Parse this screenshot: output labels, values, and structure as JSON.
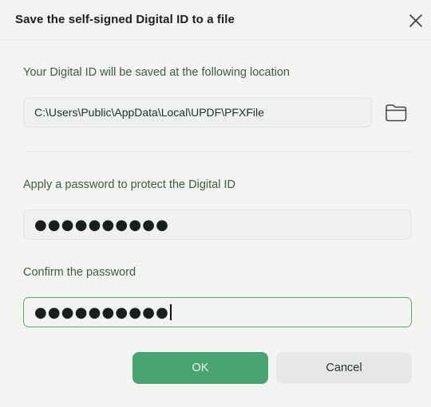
{
  "dialog": {
    "title": "Save the self-signed Digital ID to a file",
    "close_icon": "close-icon"
  },
  "location": {
    "label": "Your Digital ID will be saved at the following location",
    "path_value": "C:\\Users\\Public\\AppData\\Local\\UPDF\\PFXFile",
    "browse_icon": "folder-icon"
  },
  "password": {
    "label": "Apply a password to protect the Digital ID",
    "masked_value": "●●●●●●●●●●"
  },
  "confirm": {
    "label": "Confirm the password",
    "masked_value": "●●●●●●●●●●"
  },
  "buttons": {
    "ok_label": "OK",
    "cancel_label": "Cancel"
  },
  "colors": {
    "accent": "#4aa470",
    "focus_border": "#5ea47a",
    "background": "#f4f4f2"
  }
}
